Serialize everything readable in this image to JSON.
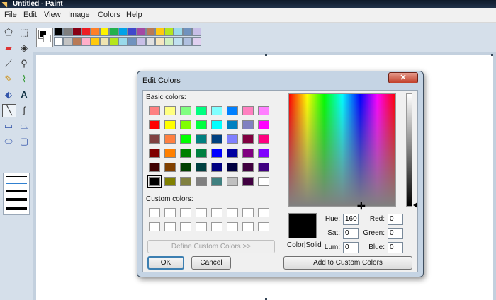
{
  "window": {
    "title": "Untitled - Paint"
  },
  "menu": [
    "File",
    "Edit",
    "View",
    "Image",
    "Colors",
    "Help"
  ],
  "tools": [
    "free-select",
    "select",
    "eraser",
    "fill",
    "color-picker",
    "magnifier",
    "pencil",
    "brush",
    "airbrush",
    "text",
    "line",
    "curve",
    "rectangle",
    "polygon",
    "ellipse",
    "rounded-rectangle"
  ],
  "palette": {
    "row1": [
      "#000000",
      "#7f7f7f",
      "#880015",
      "#ed1c24",
      "#ff7f27",
      "#fff200",
      "#22b14c",
      "#00a2e8",
      "#3f48cc",
      "#a349a4",
      "#b97a57",
      "#ffc90e",
      "#b5e61d",
      "#99d9ea",
      "#7092be",
      "#c8bfe7"
    ],
    "row2": [
      "#ffffff",
      "#c3c3c3",
      "#b97a57",
      "#ffaec9",
      "#ffc90e",
      "#efe4b0",
      "#b5e61d",
      "#99d9ea",
      "#7092be",
      "#c8bfe7",
      "#e0e0e0",
      "#f5e6c0",
      "#d0f0c0",
      "#c0e0f0",
      "#b0c0e0",
      "#e0d0f0"
    ]
  },
  "dialog": {
    "title": "Edit Colors",
    "close_label": "✕",
    "basic_colors_label": "Basic colors:",
    "custom_colors_label": "Custom colors:",
    "define_custom_label": "Define Custom Colors >>",
    "ok_label": "OK",
    "cancel_label": "Cancel",
    "add_custom_label": "Add to Custom Colors",
    "color_solid_label": "Color|Solid",
    "basic_colors": [
      [
        "#ff8080",
        "#ffff80",
        "#80ff80",
        "#00ff80",
        "#80ffff",
        "#0080ff",
        "#ff80c0",
        "#ff80ff"
      ],
      [
        "#ff0000",
        "#ffff00",
        "#80ff00",
        "#00ff40",
        "#00ffff",
        "#0080c0",
        "#8080c0",
        "#ff00ff"
      ],
      [
        "#804040",
        "#ff8040",
        "#00ff00",
        "#008080",
        "#004080",
        "#8080ff",
        "#800040",
        "#ff0080"
      ],
      [
        "#800000",
        "#ff8000",
        "#008000",
        "#008040",
        "#0000ff",
        "#0000a0",
        "#800080",
        "#8000ff"
      ],
      [
        "#400000",
        "#804000",
        "#004000",
        "#004040",
        "#000080",
        "#000040",
        "#400040",
        "#400080"
      ],
      [
        "#000000",
        "#808000",
        "#808040",
        "#808080",
        "#408080",
        "#c0c0c0",
        "#400040",
        "#ffffff"
      ]
    ],
    "fields": {
      "hue_label": "Hue:",
      "hue": "160",
      "sat_label": "Sat:",
      "sat": "0",
      "lum_label": "Lum:",
      "lum": "0",
      "red_label": "Red:",
      "red": "0",
      "green_label": "Green:",
      "green": "0",
      "blue_label": "Blue:",
      "blue": "0"
    },
    "current_color": "#000000"
  }
}
